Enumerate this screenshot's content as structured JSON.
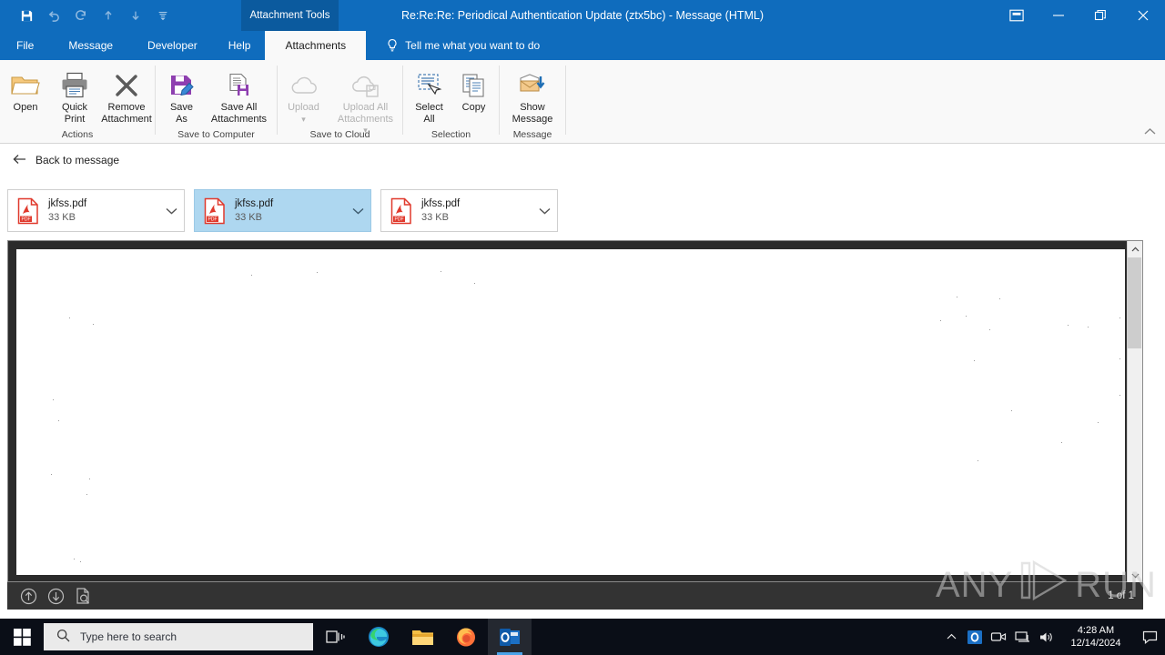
{
  "window": {
    "title": "Re:Re:Re:  Periodical Authentication Update (ztx5bc)  -  Message (HTML)",
    "contextual_tab_header": "Attachment Tools",
    "accent_color": "#0f6cbd",
    "contextual_color": "#0b5a9e"
  },
  "quick_access": {
    "items": [
      {
        "name": "save-icon",
        "label": "Save"
      },
      {
        "name": "undo-icon",
        "label": "Undo"
      },
      {
        "name": "redo-icon",
        "label": "Redo"
      },
      {
        "name": "previous-item-icon",
        "label": "Previous Item"
      },
      {
        "name": "next-item-icon",
        "label": "Next Item"
      },
      {
        "name": "customize-quick-access-icon",
        "label": "Customize Quick Access Toolbar"
      }
    ]
  },
  "window_controls": [
    {
      "name": "ribbon-display-options-button",
      "label": "Ribbon Display Options"
    },
    {
      "name": "minimize-button",
      "label": "Minimize"
    },
    {
      "name": "restore-button",
      "label": "Restore Down"
    },
    {
      "name": "close-button",
      "label": "Close"
    }
  ],
  "tabs": [
    {
      "label": "File",
      "active": false
    },
    {
      "label": "Message",
      "active": false
    },
    {
      "label": "Developer",
      "active": false
    },
    {
      "label": "Help",
      "active": false
    },
    {
      "label": "Attachments",
      "active": true
    }
  ],
  "tell_me": {
    "placeholder": "Tell me what you want to do"
  },
  "ribbon": {
    "collapse_label": "^",
    "groups": [
      {
        "label": "Actions",
        "buttons": [
          {
            "name": "open-attachment-button",
            "label": "Open",
            "icon": "folder-open-icon",
            "disabled": false
          },
          {
            "name": "quick-print-button",
            "label": "Quick\nPrint",
            "label_l1": "Quick",
            "label_l2": "Print",
            "icon": "printer-icon",
            "disabled": false
          },
          {
            "name": "remove-attachment-button",
            "label_l1": "Remove",
            "label_l2": "Attachment",
            "icon": "remove-x-icon",
            "disabled": false
          }
        ]
      },
      {
        "label": "Save to Computer",
        "buttons": [
          {
            "name": "save-as-button",
            "label_l1": "Save",
            "label_l2": "As",
            "icon": "save-as-icon",
            "disabled": false
          },
          {
            "name": "save-all-attachments-button",
            "label_l1": "Save All",
            "label_l2": "Attachments",
            "icon": "save-all-icon",
            "disabled": false
          }
        ]
      },
      {
        "label": "Save to Cloud",
        "buttons": [
          {
            "name": "upload-button",
            "label_l1": "Upload",
            "label_l2": "",
            "icon": "cloud-upload-icon",
            "disabled": true
          },
          {
            "name": "upload-all-attachments-button",
            "label_l1": "Upload All",
            "label_l2": "Attachments",
            "icon": "cloud-save-all-icon",
            "disabled": true
          }
        ]
      },
      {
        "label": "Selection",
        "buttons": [
          {
            "name": "select-all-button",
            "label_l1": "Select",
            "label_l2": "All",
            "icon": "select-all-icon",
            "disabled": false
          },
          {
            "name": "copy-button",
            "label_l1": "Copy",
            "label_l2": "",
            "icon": "copy-icon",
            "disabled": false
          }
        ]
      },
      {
        "label": "Message",
        "buttons": [
          {
            "name": "show-message-button",
            "label_l1": "Show",
            "label_l2": "Message",
            "icon": "show-message-icon",
            "disabled": false
          }
        ]
      }
    ]
  },
  "back_bar": {
    "label": "Back to message",
    "icon": "back-arrow-icon"
  },
  "attachments": [
    {
      "name": "jkfss.pdf",
      "size": "33 KB",
      "selected": false,
      "icon": "pdf-file-icon"
    },
    {
      "name": "jkfss.pdf",
      "size": "33 KB",
      "selected": true,
      "icon": "pdf-file-icon"
    },
    {
      "name": "jkfss.pdf",
      "size": "33 KB",
      "selected": false,
      "icon": "pdf-file-icon"
    }
  ],
  "preview": {
    "page_indicator": "1 of 1",
    "toolbar_buttons": [
      {
        "name": "previous-page-button",
        "label": "Previous Page"
      },
      {
        "name": "next-page-button",
        "label": "Next Page"
      },
      {
        "name": "page-view-search-button",
        "label": "Find"
      }
    ],
    "scrollbar": {
      "up": "⌃",
      "down": "⌄"
    }
  },
  "watermark": {
    "text_left": "ANY",
    "text_right": "RUN"
  },
  "taskbar": {
    "search_placeholder": "Type here to search",
    "icons": [
      {
        "name": "task-view-icon",
        "label": "Task View",
        "active": false
      },
      {
        "name": "microsoft-edge-icon",
        "label": "Microsoft Edge",
        "active": false
      },
      {
        "name": "file-explorer-icon",
        "label": "File Explorer",
        "active": false
      },
      {
        "name": "firefox-icon",
        "label": "Mozilla Firefox",
        "active": false
      },
      {
        "name": "outlook-icon",
        "label": "Microsoft Outlook",
        "active": true
      }
    ],
    "tray": [
      {
        "name": "show-hidden-icons-icon",
        "label": "Show hidden icons"
      },
      {
        "name": "outlook-tray-icon",
        "label": "Outlook"
      },
      {
        "name": "meet-now-icon",
        "label": "Meet Now"
      },
      {
        "name": "network-icon",
        "label": "Network"
      },
      {
        "name": "volume-icon",
        "label": "Volume"
      }
    ],
    "clock": {
      "time": "4:28 AM",
      "date": "12/14/2024"
    },
    "action_center": {
      "name": "action-center-icon",
      "label": "Notifications"
    }
  }
}
